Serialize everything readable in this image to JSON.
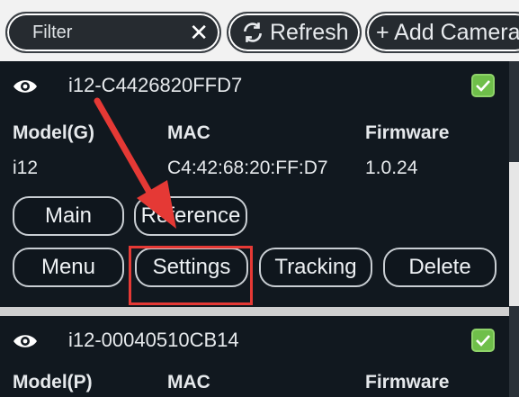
{
  "toolbar": {
    "filter_placeholder": "Filter",
    "refresh_label": "Refresh",
    "add_label": "+ Add Camera"
  },
  "cameras": [
    {
      "name": "i12-C4426820FFD7",
      "checked": true,
      "labels": {
        "model": "Model(G)",
        "mac": "MAC",
        "firmware": "Firmware"
      },
      "values": {
        "model": "i12",
        "mac": "C4:42:68:20:FF:D7",
        "firmware": "1.0.24"
      },
      "buttons": {
        "main": "Main",
        "reference": "Reference",
        "menu": "Menu",
        "settings": "Settings",
        "tracking": "Tracking",
        "delete": "Delete"
      }
    },
    {
      "name": "i12-00040510CB14",
      "checked": true,
      "labels": {
        "model": "Model(P)",
        "mac": "MAC",
        "firmware": "Firmware"
      }
    }
  ],
  "colors": {
    "panel_bg": "#11181f",
    "checkbox_green": "#6fbf4a",
    "annotation_red": "#e53935"
  },
  "icons": [
    "close-icon",
    "refresh-icon",
    "eye-icon",
    "checkbox-checked-icon",
    "annotation-arrow"
  ]
}
